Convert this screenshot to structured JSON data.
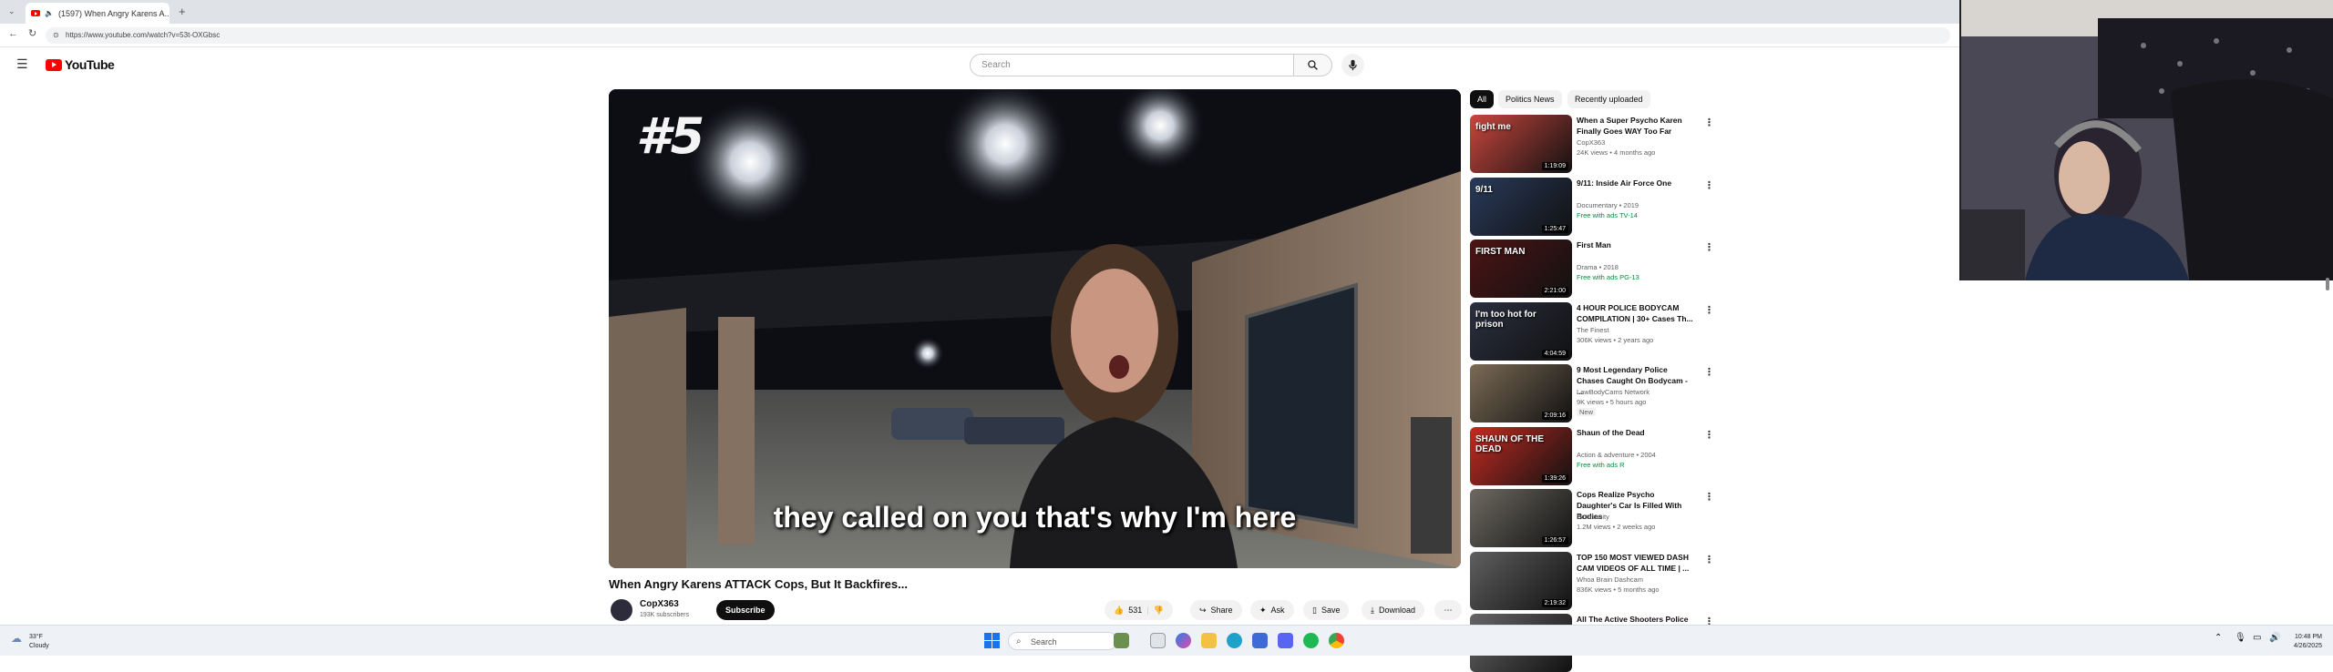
{
  "browser": {
    "tab_title": "(1597) When Angry Karens A...",
    "url": "https://www.youtube.com/watch?v=53t-OXGbsc"
  },
  "header": {
    "logo_text": "YouTube",
    "search_placeholder": "Search"
  },
  "video": {
    "overlay_rank": "#5",
    "caption": "they called on you that's why I'm here",
    "title": "When Angry Karens ATTACK Cops, But It Backfires...",
    "channel": "CopX363",
    "subscribers": "193K subscribers",
    "subscribe_label": "Subscribe",
    "like_count": "531",
    "share_label": "Share",
    "ask_label": "Ask",
    "save_label": "Save",
    "download_label": "Download"
  },
  "filters": [
    "All",
    "Politics News",
    "Recently uploaded"
  ],
  "recommendations": [
    {
      "title": "When a Super Psycho Karen Finally Goes WAY Too Far",
      "line1": "CopX363",
      "line2": "24K views • 4 months ago",
      "duration": "1:19:09",
      "thumb_text": "fight me"
    },
    {
      "title": "9/11: Inside Air Force One",
      "line1": "Documentary • 2019",
      "line2": "Free with ads  TV-14",
      "duration": "1:25:47",
      "thumb_text": "9/11"
    },
    {
      "title": "First Man",
      "line1": "Drama • 2018",
      "line2": "Free with ads  PG-13",
      "duration": "2:21:00",
      "thumb_text": "FIRST MAN"
    },
    {
      "title": "4 HOUR POLICE BODYCAM COMPILATION | 30+ Cases Th...",
      "line1": "The Finest",
      "line2": "306K views • 2 years ago",
      "duration": "4:04:59",
      "thumb_text": "I'm too hot for prison"
    },
    {
      "title": "9 Most Legendary Police Chases Caught On Bodycam - ...",
      "line1": "LawBodyCams Network",
      "line2": "9K views • 5 hours ago",
      "line3": "New",
      "duration": "2:09:16",
      "thumb_text": ""
    },
    {
      "title": "Shaun of the Dead",
      "line1": "Action & adventure • 2004",
      "line2": "Free with ads  R",
      "duration": "1:39:26",
      "thumb_text": "SHAUN OF THE DEAD"
    },
    {
      "title": "Cops Realize Psycho Daughter's Car Is Filled With Bodies",
      "line1": "Dr Insanity",
      "line2": "1.2M views • 2 weeks ago",
      "duration": "1:26:57",
      "thumb_text": ""
    },
    {
      "title": "TOP 150 MOST VIEWED DASH CAM VIDEOS OF ALL TIME | ...",
      "line1": "Whoa Brain Dashcam",
      "line2": "836K views • 5 months ago",
      "duration": "2:19:32",
      "thumb_text": ""
    },
    {
      "title": "All The Active Shooters Police ...",
      "line1": "",
      "line2": "",
      "duration": "",
      "thumb_text": ""
    }
  ],
  "taskbar": {
    "weather_temp": "33°F",
    "weather_desc": "Cloudy",
    "search_label": "Search",
    "time": "10:48 PM",
    "date": "4/26/2025"
  },
  "colors": {
    "accent": "#ff0000",
    "chip_active": "#0f0f0f",
    "free_with_ads": "#0a8a3a"
  }
}
